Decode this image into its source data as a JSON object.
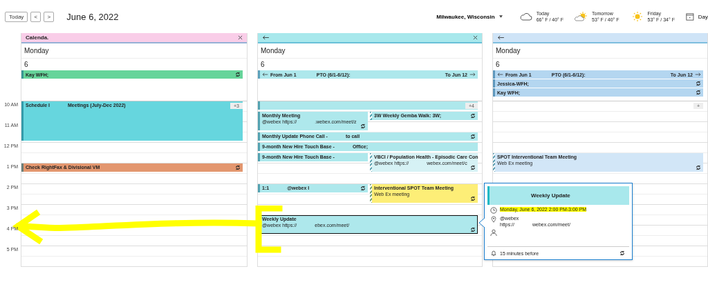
{
  "toolbar": {
    "today_button": "Today",
    "prev_button": "<",
    "next_button": ">",
    "date_title": "June 6, 2022",
    "location": "Milwaukee, Wisconsin",
    "forecast": [
      {
        "kind": "cloudy",
        "day": "Today",
        "temps": "66° F / 40° F"
      },
      {
        "kind": "partly_sunny",
        "day": "Tomorrow",
        "temps": "53° F / 40° F"
      },
      {
        "kind": "sunny",
        "day": "Friday",
        "temps": "53° F / 34° F"
      }
    ],
    "view_button": "Day"
  },
  "panes": [
    {
      "title": [
        "Calenda."
      ],
      "closable": true,
      "color": "#f9cde8",
      "day_name": "Monday",
      "day_number": "6",
      "all_day": [
        {
          "color": "#66d49a",
          "text": [
            "Kay WFH;"
          ],
          "recurring": true
        }
      ],
      "overflow_badge": "+3"
    },
    {
      "back": true,
      "closable": true,
      "color": "#a8e8ec",
      "day_name": "Monday",
      "day_number": "6",
      "all_day": [
        {
          "color": "#aee8ec",
          "continues_before": true,
          "text": [
            "From Jun 1",
            "PTO (6/1-6/12):"
          ],
          "to": "To Jun 12"
        }
      ],
      "overflow_badge": "+4"
    },
    {
      "back": true,
      "color": "#cfe4f7",
      "day_name": "Monday",
      "day_number": "6",
      "all_day": [
        {
          "color": "#b4d6f0",
          "continues_before": true,
          "text": [
            "From Jun 1",
            "PTO (6/1-6/12):"
          ],
          "to": "To Jun 12"
        },
        {
          "color": "#b4d6f0",
          "text": [
            "Jessica-WFH;"
          ],
          "recurring": true
        },
        {
          "color": "#b4d6f0",
          "text": [
            "Kay WFH;"
          ],
          "recurring": true
        }
      ],
      "overflow_badge": "+"
    }
  ],
  "time_rows": [
    {
      "label": "10 AM",
      "first_calendar": [
        {
          "kind": "double",
          "half_past": false,
          "color": "#66d6de",
          "selected": false,
          "lines": [
            [
              "Schedule I",
              "Meetings (July-Dec 2022)"
            ]
          ]
        }
      ],
      "second_calendar": [
        {
          "kind": "short",
          "half_past": false,
          "color": "#aee8ec",
          "selected": false
        },
        {
          "kind": "hour",
          "half_past": true,
          "color": "#aee8ec",
          "recurring": true,
          "selected": false,
          "lines": [
            [
              "Monthly Meeting"
            ],
            [
              "@webex  https://",
              ".webex.com/meet/z"
            ]
          ]
        },
        {
          "kind": "short",
          "half_past": true,
          "color": "#aee8ec",
          "tentative": true,
          "recurring": true,
          "selected": false,
          "lines": [
            [
              "3W Weekly Gemba Walk: 3W;"
            ]
          ]
        }
      ]
    },
    {
      "label": "11 AM",
      "second_calendar": [
        {
          "kind": "short",
          "half_past": true,
          "color": "#aee8ec",
          "recurring": true,
          "selected": false,
          "lines": [
            [
              "Monthly Update Phone Call -",
              "to call"
            ]
          ]
        }
      ]
    },
    {
      "label": "12 PM",
      "second_calendar": [
        {
          "kind": "short",
          "half_past": false,
          "color": "#aee8ec",
          "selected": false,
          "lines": [
            [
              "9-month New Hire Touch Base -",
              "Office;"
            ]
          ]
        },
        {
          "kind": "short",
          "half_past": true,
          "color": "#aee8ec",
          "selected": false,
          "lines": [
            [
              "9-month New Hire Touch Base -"
            ]
          ]
        },
        {
          "kind": "hour",
          "half_past": true,
          "color": "#d6f2f5",
          "tentative": true,
          "recurring": true,
          "selected": false,
          "lines": [
            [
              "VBCI / Population Health - Episodic Care Con"
            ],
            [
              "@webex https://",
              "webex.com/meet/c"
            ]
          ]
        }
      ],
      "third_calendar": [
        {
          "kind": "hour",
          "half_past": true,
          "color": "#d2e6f7",
          "tentative": true,
          "recurring": true,
          "selected": false,
          "lines": [
            [
              "SPOT Interventional Team Meeting"
            ],
            [
              "Web Ex meeting"
            ]
          ]
        }
      ]
    },
    {
      "label": "1 PM",
      "first_calendar": [
        {
          "kind": "short",
          "half_past": false,
          "color": "#e3976f",
          "recurring": true,
          "selected": false,
          "lines": [
            [
              "Check RightFax & Divisional VM"
            ]
          ]
        }
      ]
    },
    {
      "label": "2 PM",
      "second_calendar": [
        {
          "kind": "short",
          "half_past": false,
          "color": "#aee8ec",
          "recurring": true,
          "selected": false,
          "lines": [
            [
              "1:1",
              "@webex I"
            ]
          ]
        },
        {
          "kind": "hour",
          "half_past": false,
          "color": "#fdee77",
          "tentative": true,
          "recurring": true,
          "selected": false,
          "lines": [
            [
              "Interventional SPOT Team Meeting"
            ],
            [
              "Web Ex meeting"
            ]
          ]
        }
      ]
    },
    {
      "label": "3 PM",
      "second_calendar": [
        {
          "kind": "hour",
          "half_past": true,
          "color": "#aee8ec",
          "recurring": true,
          "selected": true,
          "lines": [
            [
              "Weekly Update"
            ],
            [
              "@webex https://",
              "ebex.com/meet/"
            ]
          ]
        }
      ]
    },
    {
      "label": "4 PM"
    },
    {
      "label": "5 PM"
    }
  ],
  "popup": {
    "title": "Weekly Update",
    "when": "Monday, June 6, 2022 2:00 PM-3:00 PM",
    "location": [
      [
        "@webex"
      ],
      [
        "https://",
        "webex.com/meet/"
      ]
    ],
    "reminder": "15 minutes before",
    "recurring": true
  }
}
